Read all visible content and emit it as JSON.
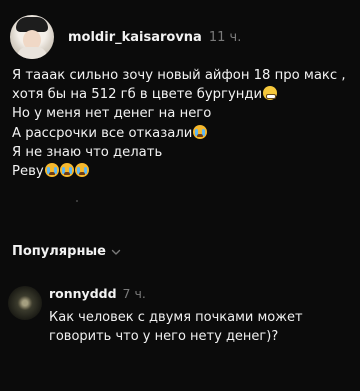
{
  "post": {
    "author": "moldir_kaisarovna",
    "time": "11 ч.",
    "lines": [
      "Я тааак сильно зочу новый айфон 18 про макс ,",
      "хотя бы на 512 гб в цвете бургунди",
      "Но у меня нет денег на него",
      "А рассрочки все отказали",
      "Я не знаю что делать",
      "Реву"
    ],
    "emojis": {
      "line2": "grimacing-face-icon",
      "line4": "crying-face-icon",
      "line6": [
        "crying-face-icon",
        "crying-face-icon",
        "crying-face-icon"
      ]
    }
  },
  "sort": {
    "label": "Популярные",
    "icon": "chevron-down-icon"
  },
  "comment": {
    "author": "ronnyddd",
    "time": "7 ч.",
    "text": "Как человек с двумя почками может говорить что у него нету денег)?"
  },
  "colors": {
    "background": "#0b0b0b",
    "text": "#f2f2f2",
    "muted": "#7a7a7a"
  }
}
